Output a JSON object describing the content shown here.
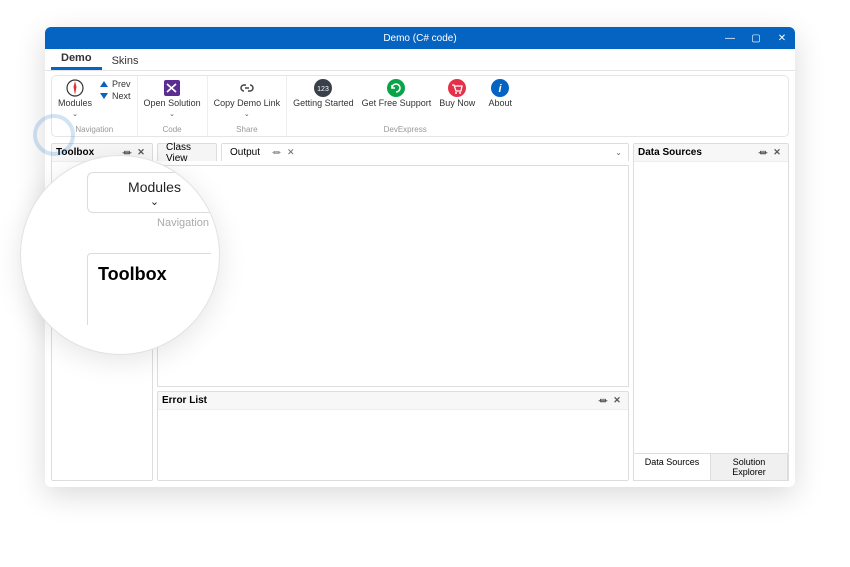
{
  "window": {
    "title": "Demo (C# code)"
  },
  "tabs": [
    {
      "label": "Demo",
      "active": true
    },
    {
      "label": "Skins",
      "active": false
    }
  ],
  "ribbon": {
    "groups": [
      {
        "label": "Navigation",
        "items": [
          {
            "kind": "big",
            "label": "Modules",
            "icon": "compass",
            "chevron": true
          },
          {
            "kind": "mini",
            "prev": "Prev",
            "next": "Next"
          }
        ]
      },
      {
        "label": "Code",
        "items": [
          {
            "kind": "big",
            "label": "Open Solution",
            "icon": "vs",
            "chevron": true
          }
        ]
      },
      {
        "label": "Share",
        "items": [
          {
            "kind": "big",
            "label": "Copy Demo Link",
            "icon": "link",
            "chevron": true
          }
        ]
      },
      {
        "label": "DevExpress",
        "items": [
          {
            "kind": "big",
            "label": "Getting Started",
            "icon": "123"
          },
          {
            "kind": "big",
            "label": "Get Free Support",
            "icon": "refresh"
          },
          {
            "kind": "big",
            "label": "Buy Now",
            "icon": "cart"
          },
          {
            "kind": "big",
            "label": "About",
            "icon": "info"
          }
        ]
      }
    ]
  },
  "panes": {
    "toolbox": {
      "title": "Toolbox"
    },
    "classview": {
      "title": "Class View"
    },
    "output": {
      "title": "Output"
    },
    "errorlist": {
      "title": "Error List"
    },
    "datasources": {
      "title": "Data Sources"
    },
    "right_tabs": [
      "Data Sources",
      "Solution Explorer"
    ]
  },
  "magnifier": {
    "modules": "Modules",
    "navigation": "Navigation",
    "toolbox": "Toolbox"
  },
  "glyphs": {
    "pin": "⏛",
    "close": "✕",
    "chevron_down": "⌄",
    "expand": "⌄",
    "minimize": "—",
    "maximize": "▢"
  }
}
